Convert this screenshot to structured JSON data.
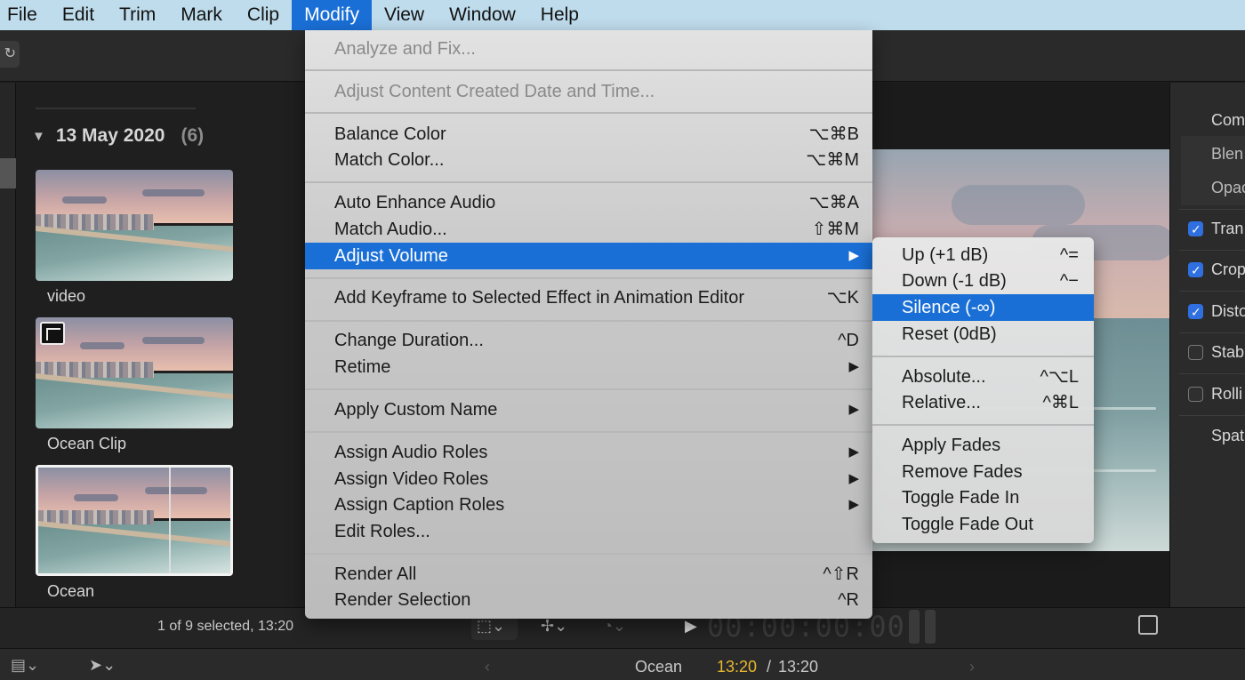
{
  "menubar": {
    "items": [
      "File",
      "Edit",
      "Trim",
      "Mark",
      "Clip",
      "Modify",
      "View",
      "Window",
      "Help"
    ],
    "active": "Modify"
  },
  "browser": {
    "date_label": "13 May 2020",
    "date_count": "(6)",
    "clips": [
      {
        "label": "video"
      },
      {
        "label": "Ocean Clip"
      },
      {
        "label": "Ocean"
      }
    ],
    "status": "1 of 9 selected, 13:20"
  },
  "modify_menu": {
    "items": [
      {
        "label": "Analyze and Fix...",
        "shortcut": "",
        "disabled": true
      },
      {
        "label": "Adjust Content Created Date and Time...",
        "shortcut": "",
        "disabled": true
      },
      {
        "label": "Balance Color",
        "shortcut": "⌥⌘B"
      },
      {
        "label": "Match Color...",
        "shortcut": "⌥⌘M"
      },
      {
        "label": "Auto Enhance Audio",
        "shortcut": "⌥⌘A"
      },
      {
        "label": "Match Audio...",
        "shortcut": "⇧⌘M"
      },
      {
        "label": "Adjust Volume",
        "shortcut": "▶",
        "highlighted": true
      },
      {
        "label": "Add Keyframe to Selected Effect in Animation Editor",
        "shortcut": "⌥K"
      },
      {
        "label": "Change Duration...",
        "shortcut": "^D"
      },
      {
        "label": "Retime",
        "shortcut": "▶"
      },
      {
        "label": "Apply Custom Name",
        "shortcut": "▶"
      },
      {
        "label": "Assign Audio Roles",
        "shortcut": "▶"
      },
      {
        "label": "Assign Video Roles",
        "shortcut": "▶"
      },
      {
        "label": "Assign Caption Roles",
        "shortcut": "▶"
      },
      {
        "label": "Edit Roles...",
        "shortcut": ""
      },
      {
        "label": "Render All",
        "shortcut": "^⇧R"
      },
      {
        "label": "Render Selection",
        "shortcut": "^R"
      }
    ]
  },
  "volume_submenu": {
    "items": [
      {
        "label": "Up (+1 dB)",
        "shortcut": "^="
      },
      {
        "label": "Down (-1 dB)",
        "shortcut": "^−"
      },
      {
        "label": "Silence (-∞)",
        "shortcut": "",
        "highlighted": true
      },
      {
        "label": "Reset (0dB)",
        "shortcut": ""
      },
      {
        "label": "Absolute...",
        "shortcut": "^⌥L"
      },
      {
        "label": "Relative...",
        "shortcut": "^⌘L"
      },
      {
        "label": "Apply Fades",
        "shortcut": ""
      },
      {
        "label": "Remove Fades",
        "shortcut": ""
      },
      {
        "label": "Toggle Fade In",
        "shortcut": ""
      },
      {
        "label": "Toggle Fade Out",
        "shortcut": ""
      }
    ]
  },
  "inspector": {
    "rows": [
      {
        "label": "Com",
        "checked": null
      },
      {
        "label": "Blen",
        "checked": null
      },
      {
        "label": "Opac",
        "checked": null
      },
      {
        "label": "Tran",
        "checked": true
      },
      {
        "label": "Crop",
        "checked": true
      },
      {
        "label": "Disto",
        "checked": true
      },
      {
        "label": "Stab",
        "checked": false
      },
      {
        "label": "Rolli",
        "checked": false
      },
      {
        "label": "Spat",
        "checked": null
      }
    ]
  },
  "viewer": {
    "timecode": "00:00:00:00"
  },
  "timeline_bar": {
    "project_name": "Ocean",
    "current_time": "13:20",
    "separator": " / ",
    "total_time": "13:20"
  },
  "colors": {
    "menubar_bg": "#bfdcec",
    "highlight": "#1a6fd6",
    "timecode_yellow": "#e8b830"
  }
}
